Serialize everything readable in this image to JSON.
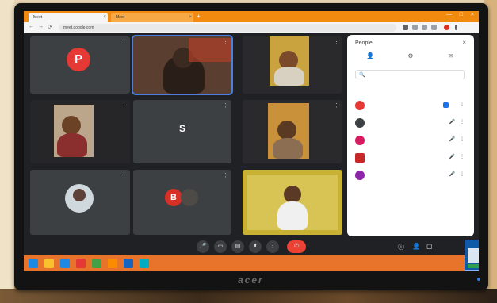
{
  "browser": {
    "tabs": [
      {
        "label": "Meet",
        "close": "×"
      },
      {
        "label": "Meet - ",
        "close": "×"
      }
    ],
    "new_tab": "+",
    "window_controls": [
      "—",
      "□",
      "×"
    ],
    "nav": {
      "back": "←",
      "forward": "→",
      "reload": "⟳"
    },
    "url": "meet.google.com"
  },
  "meeting": {
    "tiles": [
      {
        "id": "p",
        "initial": "P",
        "name": "",
        "more": "⋮",
        "color": "#e53935"
      },
      {
        "id": "speaker",
        "name": "",
        "more": "⋮"
      },
      {
        "id": "tr1",
        "name": "",
        "more": "⋮"
      },
      {
        "id": "ml",
        "name": "",
        "more": "⋮"
      },
      {
        "id": "s",
        "initial": "S",
        "name": "",
        "more": "⋮"
      },
      {
        "id": "mr",
        "name": "",
        "more": "⋮"
      },
      {
        "id": "bl",
        "name": "",
        "more": "⋮"
      },
      {
        "id": "bm",
        "initial": "B",
        "name": "",
        "more": "⋮",
        "color": "#d93025"
      },
      {
        "id": "br",
        "name": ""
      }
    ],
    "info": "",
    "controls": {
      "mic": "🎤",
      "camera": "▭",
      "captions": "▤",
      "present": "⬆",
      "more": "⋮",
      "end": "✆"
    },
    "right_controls": {
      "info": "ⓘ",
      "people": "👤",
      "chat": "▢"
    }
  },
  "panel": {
    "title": "People",
    "close": "×",
    "tabs": [
      {
        "icon": "👤",
        "label": ""
      },
      {
        "icon": "⚙",
        "label": ""
      },
      {
        "icon": "✉",
        "label": ""
      }
    ],
    "search_icon": "🔍",
    "search_placeholder": "",
    "section": "",
    "participants": [
      {
        "name": "",
        "color": "#e53935",
        "mic": "🎤",
        "more": "⋮",
        "pinned": true
      },
      {
        "name": "",
        "color": "#3c4043",
        "mic": "🎤",
        "more": "⋮"
      },
      {
        "name": "",
        "color": "#d81b60",
        "mic": "🎤",
        "more": "⋮"
      },
      {
        "name": "",
        "color": "#c62828",
        "mic": "🎤",
        "more": "⋮"
      },
      {
        "name": "",
        "color": "#8e24aa",
        "mic": "🎤",
        "more": "⋮"
      }
    ]
  },
  "taskbar": {
    "tray": "",
    "icons": [
      "#1e88e5",
      "#fbc02d",
      "#1e88e5",
      "#e53935",
      "#43a047",
      "#fb8c00",
      "#1565c0",
      "#00acc1"
    ]
  },
  "popup": {
    "title": ""
  },
  "monitor": {
    "brand": "acer"
  }
}
